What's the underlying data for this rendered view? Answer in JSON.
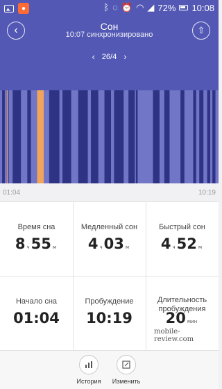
{
  "status_bar": {
    "battery": "72%",
    "time": "10:08",
    "icons": [
      "image-icon",
      "app-icon",
      "bluetooth-icon",
      "mute-icon",
      "alarm-icon",
      "wifi-icon",
      "signal-icon",
      "battery-icon"
    ]
  },
  "header": {
    "title": "Сон",
    "subtitle": "10:07 синхронизировано",
    "date": "26/4"
  },
  "timeline": {
    "start": "01:04",
    "end": "10:19"
  },
  "colors": {
    "deep": "#2f3383",
    "light": "#7276c6",
    "awake": "#f2a55a",
    "background": "#5358b4"
  },
  "chart_data": {
    "type": "bar",
    "segments": [
      {
        "stage": "light",
        "start": 0.0,
        "end": 0.01
      },
      {
        "stage": "deep",
        "start": 0.01,
        "end": 0.022
      },
      {
        "stage": "light",
        "start": 0.022,
        "end": 0.032
      },
      {
        "stage": "awake",
        "start": 0.032,
        "end": 0.036
      },
      {
        "stage": "deep",
        "start": 0.036,
        "end": 0.04
      },
      {
        "stage": "light",
        "start": 0.04,
        "end": 0.058
      },
      {
        "stage": "deep",
        "start": 0.058,
        "end": 0.096
      },
      {
        "stage": "light",
        "start": 0.096,
        "end": 0.125
      },
      {
        "stage": "deep",
        "start": 0.125,
        "end": 0.142
      },
      {
        "stage": "light",
        "start": 0.142,
        "end": 0.17
      },
      {
        "stage": "awake",
        "start": 0.17,
        "end": 0.2
      },
      {
        "stage": "light",
        "start": 0.2,
        "end": 0.225
      },
      {
        "stage": "deep",
        "start": 0.225,
        "end": 0.272
      },
      {
        "stage": "light",
        "start": 0.272,
        "end": 0.286
      },
      {
        "stage": "deep",
        "start": 0.286,
        "end": 0.326
      },
      {
        "stage": "light",
        "start": 0.326,
        "end": 0.358
      },
      {
        "stage": "deep",
        "start": 0.358,
        "end": 0.402
      },
      {
        "stage": "light",
        "start": 0.402,
        "end": 0.416
      },
      {
        "stage": "deep",
        "start": 0.416,
        "end": 0.45
      },
      {
        "stage": "light",
        "start": 0.45,
        "end": 0.478
      },
      {
        "stage": "deep",
        "start": 0.478,
        "end": 0.508
      },
      {
        "stage": "light",
        "start": 0.508,
        "end": 0.522
      },
      {
        "stage": "deep",
        "start": 0.522,
        "end": 0.566
      },
      {
        "stage": "light",
        "start": 0.566,
        "end": 0.588
      },
      {
        "stage": "deep",
        "start": 0.588,
        "end": 0.617
      },
      {
        "stage": "light",
        "start": 0.617,
        "end": 0.622
      },
      {
        "stage": "deep",
        "start": 0.622,
        "end": 0.63
      },
      {
        "stage": "light",
        "start": 0.63,
        "end": 0.7
      },
      {
        "stage": "deep",
        "start": 0.7,
        "end": 0.73
      },
      {
        "stage": "light",
        "start": 0.73,
        "end": 0.752
      },
      {
        "stage": "deep",
        "start": 0.752,
        "end": 0.776
      },
      {
        "stage": "light",
        "start": 0.776,
        "end": 0.826
      },
      {
        "stage": "deep",
        "start": 0.826,
        "end": 0.844
      },
      {
        "stage": "light",
        "start": 0.844,
        "end": 0.884
      },
      {
        "stage": "deep",
        "start": 0.884,
        "end": 0.898
      },
      {
        "stage": "light",
        "start": 0.898,
        "end": 0.912
      },
      {
        "stage": "deep",
        "start": 0.912,
        "end": 0.931
      },
      {
        "stage": "light",
        "start": 0.931,
        "end": 0.948
      },
      {
        "stage": "deep",
        "start": 0.948,
        "end": 0.962
      },
      {
        "stage": "light",
        "start": 0.962,
        "end": 0.972
      },
      {
        "stage": "deep",
        "start": 0.972,
        "end": 0.986
      },
      {
        "stage": "light",
        "start": 0.986,
        "end": 1.0
      }
    ]
  },
  "stats": {
    "sleep_time": {
      "label": "Время сна",
      "h": "8",
      "h_unit": "ч",
      "m": "55",
      "m_unit": "м"
    },
    "light_sleep": {
      "label": "Медленный сон",
      "h": "4",
      "h_unit": "ч",
      "m": "03",
      "m_unit": "м"
    },
    "deep_sleep": {
      "label": "Быстрый сон",
      "h": "4",
      "h_unit": "ч",
      "m": "52",
      "m_unit": "м"
    },
    "sleep_start": {
      "label": "Начало сна",
      "value": "01:04"
    },
    "wake_up": {
      "label": "Пробуждение",
      "value": "10:19"
    },
    "wake_duration": {
      "label": "Длительность пробуждения",
      "value": "20",
      "unit": "мин"
    }
  },
  "watermark": "mobile-review.com",
  "bottom_bar": {
    "history_label": "История",
    "edit_label": "Изменить"
  }
}
